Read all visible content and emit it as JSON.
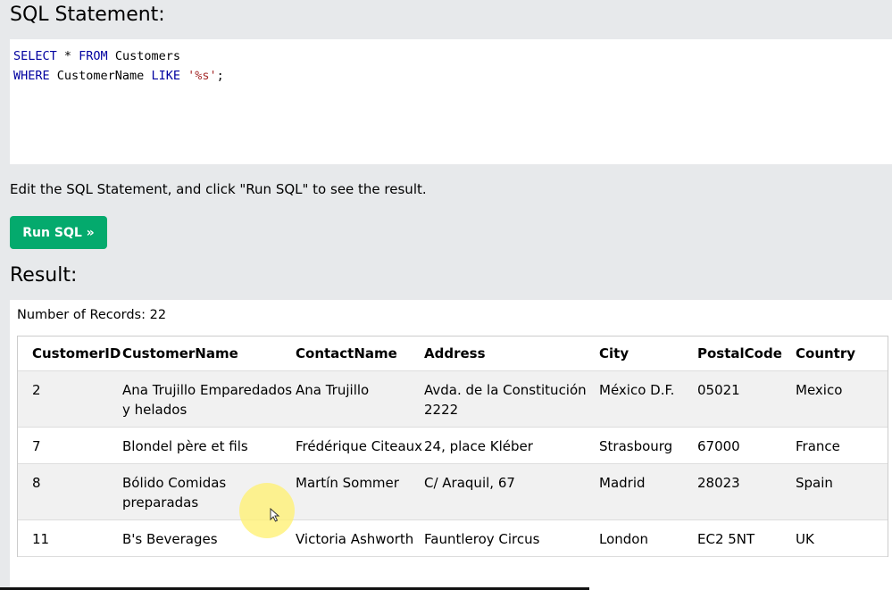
{
  "sql_section": {
    "title": "SQL Statement:",
    "query_line1": {
      "kw1": "SELECT",
      "mid1": " * ",
      "kw2": "FROM",
      "rest": " Customers"
    },
    "query_line2": {
      "kw1": "WHERE",
      "mid1": " CustomerName ",
      "kw2": "LIKE",
      "space": " ",
      "str": "'%s'",
      "end": ";"
    }
  },
  "hint_text": "Edit the SQL Statement, and click \"Run SQL\" to see the result.",
  "run_button_label": "Run SQL »",
  "result_section": {
    "title": "Result:",
    "records_label": "Number of Records: 22"
  },
  "table": {
    "headers": [
      "CustomerID",
      "CustomerName",
      "ContactName",
      "Address",
      "City",
      "PostalCode",
      "Country"
    ],
    "rows": [
      [
        "2",
        "Ana Trujillo Emparedados y helados",
        "Ana Trujillo",
        "Avda. de la Constitución 2222",
        "México D.F.",
        "05021",
        "Mexico"
      ],
      [
        "7",
        "Blondel père et fils",
        "Frédérique Citeaux",
        "24, place Kléber",
        "Strasbourg",
        "67000",
        "France"
      ],
      [
        "8",
        "Bólido Comidas preparadas",
        "Martín Sommer",
        "C/ Araquil, 67",
        "Madrid",
        "28023",
        "Spain"
      ],
      [
        "11",
        "B's Beverages",
        "Victoria Ashworth",
        "Fauntleroy Circus",
        "London",
        "EC2 5NT",
        "UK"
      ]
    ]
  },
  "colors": {
    "accent": "#04aa6d",
    "background": "#e7e9eb",
    "keyword": "#0000a0",
    "string": "#a52a2a"
  }
}
